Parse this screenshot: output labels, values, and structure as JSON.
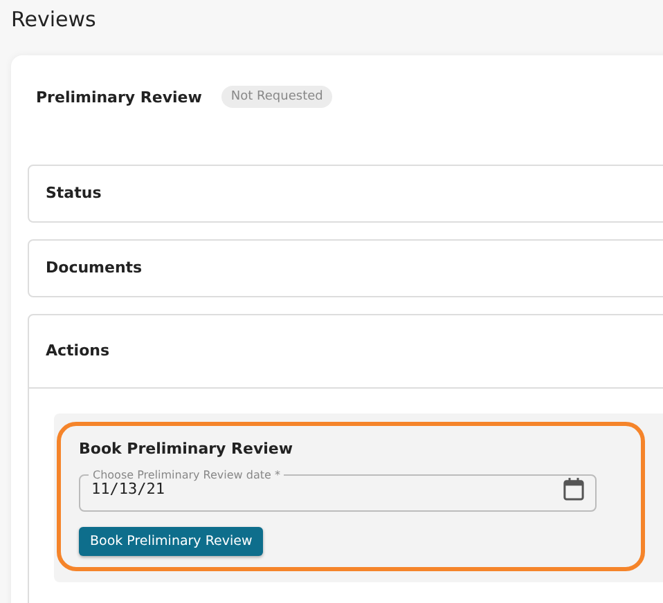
{
  "page_title": "Reviews",
  "review": {
    "title": "Preliminary Review",
    "status": "Not Requested"
  },
  "sections": [
    {
      "title": "Status",
      "expanded": false
    },
    {
      "title": "Documents",
      "expanded": false
    },
    {
      "title": "Actions",
      "expanded": true,
      "form": {
        "title": "Book Preliminary Review",
        "highlighted": true,
        "date_field": {
          "label": "Choose Preliminary Review date *",
          "value": "11/13/21"
        },
        "button": "Book Preliminary Review"
      }
    }
  ]
}
